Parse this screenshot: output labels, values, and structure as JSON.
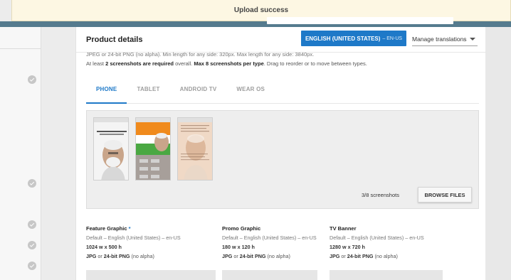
{
  "toast": {
    "message": "Upload success"
  },
  "header": {
    "title": "Product details",
    "language_button": {
      "label": "ENGLISH (UNITED STATES)",
      "code": "– EN-US"
    },
    "manage_translations": "Manage translations"
  },
  "info": {
    "line1": "JPEG or 24-bit PNG (no alpha). Min length for any side: 320px. Max length for any side: 3840px.",
    "line2_prefix": "At least ",
    "line2_bold1": "2 screenshots are required",
    "line2_mid": " overall. ",
    "line2_bold2": "Max 8 screenshots per type",
    "line2_suffix": ". Drag to reorder or to move between types."
  },
  "tabs": [
    {
      "label": "PHONE",
      "active": true
    },
    {
      "label": "TABLET",
      "active": false
    },
    {
      "label": "ANDROID TV",
      "active": false
    },
    {
      "label": "WEAR OS",
      "active": false
    }
  ],
  "screenshots": {
    "count_label": "3/8 screenshots",
    "browse_label": "BROWSE FILES",
    "thumbnails": [
      "screenshot-1",
      "screenshot-2",
      "screenshot-3"
    ]
  },
  "graphics": [
    {
      "name": "Feature Graphic",
      "required": "*",
      "lang": "Default – English (United States) – en-US",
      "size": "1024 w x 500 h",
      "fmt_a": "JPG",
      "fmt_or": " or ",
      "fmt_b": "24-bit PNG",
      "fmt_tail": " (no alpha)"
    },
    {
      "name": "Promo Graphic",
      "required": "",
      "lang": "Default – English (United States) – en-US",
      "size": "180 w x 120 h",
      "fmt_a": "JPG",
      "fmt_or": " or ",
      "fmt_b": "24-bit PNG",
      "fmt_tail": " (no alpha)"
    },
    {
      "name": "TV Banner",
      "required": "",
      "lang": "Default – English (United States) – en-US",
      "size": "1280 w x 720 h",
      "fmt_a": "JPG",
      "fmt_or": " or ",
      "fmt_b": "24-bit PNG",
      "fmt_tail": " (no alpha)"
    }
  ],
  "colors": {
    "accent": "#1e79c8",
    "appbar": "#557b8e",
    "toast_bg": "#fdf7e3"
  },
  "sidebar": {
    "status_icons": [
      "check-circle-icon",
      "check-circle-icon",
      "check-circle-icon",
      "check-circle-icon",
      "check-circle-icon"
    ]
  }
}
